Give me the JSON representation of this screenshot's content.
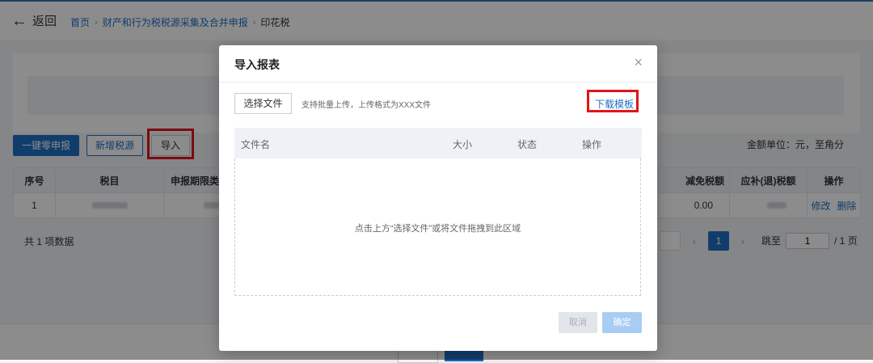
{
  "nav": {
    "back_label": "返回",
    "breadcrumbs": [
      "首页",
      "财产和行为税税源采集及合并申报",
      "印花税"
    ]
  },
  "toolbar": {
    "zero_declare": "一键零申报",
    "add_source": "新增税源",
    "import": "导入",
    "unit_note": "金额单位：元，至角分"
  },
  "table": {
    "headers": [
      "序号",
      "税目",
      "申报期限类",
      "减免税额",
      "应补(退)税额",
      "操作"
    ],
    "rows": [
      {
        "index": "1",
        "relief": "0.00",
        "actions": [
          "修改",
          "删除"
        ]
      }
    ]
  },
  "footer": {
    "total": "共 1 项数据",
    "current_page": "1",
    "jump_label": "跳至",
    "jump_value": "1",
    "page_total": "/ 1 页"
  },
  "modal": {
    "title": "导入报表",
    "close": "×",
    "choose_file": "选择文件",
    "hint": "支持批量上传，上传格式为XXX文件",
    "download_template": "下载模板",
    "columns": [
      "文件名",
      "大小",
      "状态",
      "操作"
    ],
    "drop_text": "点击上方“选择文件”或将文件拖拽到此区域",
    "cancel": "取消",
    "confirm": "确定"
  },
  "colors": {
    "primary": "#1f6fc5",
    "highlight_red": "#e0151b",
    "mask": "rgba(0,0,0,0.45)"
  }
}
